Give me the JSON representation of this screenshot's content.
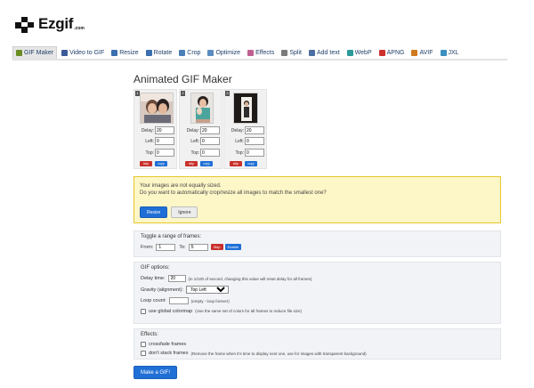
{
  "logo": {
    "text": "Ezgif",
    "sub": ".com"
  },
  "nav": [
    {
      "label": "GIF Maker",
      "icon": "gif-maker-icon",
      "color": "#6b8e23",
      "active": true
    },
    {
      "label": "Video to GIF",
      "icon": "video-to-gif-icon",
      "color": "#3a5a98"
    },
    {
      "label": "Resize",
      "icon": "resize-icon",
      "color": "#3a6fb0"
    },
    {
      "label": "Rotate",
      "icon": "rotate-icon",
      "color": "#3a6fb0"
    },
    {
      "label": "Crop",
      "icon": "crop-icon",
      "color": "#4a7fb8"
    },
    {
      "label": "Optimize",
      "icon": "optimize-icon",
      "color": "#5b8cc0"
    },
    {
      "label": "Effects",
      "icon": "effects-icon",
      "color": "#c06090"
    },
    {
      "label": "Split",
      "icon": "split-icon",
      "color": "#7a7a7a"
    },
    {
      "label": "Add text",
      "icon": "add-text-icon",
      "color": "#4a6fa0"
    },
    {
      "label": "WebP",
      "icon": "webp-icon",
      "color": "#2a9a9a"
    },
    {
      "label": "APNG",
      "icon": "apng-icon",
      "color": "#d03030"
    },
    {
      "label": "AVIF",
      "icon": "avif-icon",
      "color": "#d07a20"
    },
    {
      "label": "JXL",
      "icon": "jxl-icon",
      "color": "#3a8fc0"
    }
  ],
  "title": "Animated GIF Maker",
  "frames": [
    {
      "num": "1",
      "delay": "20",
      "left": "0",
      "top": "0"
    },
    {
      "num": "2",
      "delay": "20",
      "left": "0",
      "top": "0"
    },
    {
      "num": "3",
      "delay": "20",
      "left": "0",
      "top": "0"
    }
  ],
  "frame_labels": {
    "delay": "Delay:",
    "left": "Left:",
    "top": "Top:",
    "skip": "skip",
    "copy": "copy"
  },
  "warning": {
    "line1": "Your images are not equally sized.",
    "line2": "Do you want to automatically crop/resize all images to match the smallest one?",
    "resize": "Resize",
    "ignore": "Ignore"
  },
  "toggle": {
    "heading": "Toggle a range of frames:",
    "from_label": "From:",
    "from_value": "1",
    "to_label": "To:",
    "to_value": "5",
    "skip": "Skip",
    "enable": "Enable"
  },
  "options": {
    "heading": "GIF options:",
    "delay_label": "Delay time:",
    "delay_value": "20",
    "delay_note": "(in 1/100 of second, changing this value will reset delay for all frames)",
    "gravity_label": "Gravity (alignment):",
    "gravity_value": "Top Left",
    "loop_label": "Loop count:",
    "loop_value": "",
    "loop_note": "(empty - loop forever)",
    "colormap_label": "use global colormap",
    "colormap_note": "(Use the same set of colors for all frames to reduce file size)"
  },
  "effects": {
    "heading": "Effects:",
    "crossfade": "crossfade frames",
    "nostack": "don't stack frames",
    "nostack_note": "(Remove the frame when it's time to display next one, use for images with transparent background)"
  },
  "make_button": "Make a GIF!"
}
